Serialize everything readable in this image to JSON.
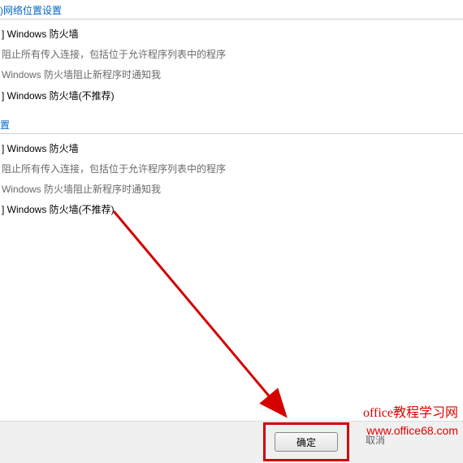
{
  "section1": {
    "header": ")网络位置设置",
    "opt_enable": "] Windows 防火墙",
    "opt_block": "阻止所有传入连接，包括位于允许程序列表中的程序",
    "opt_notify": "Windows 防火墙阻止新程序时通知我",
    "opt_disable": "] Windows 防火墙(不推荐)"
  },
  "section2": {
    "header": "置",
    "opt_enable": "] Windows 防火墙",
    "opt_block": "阻止所有传入连接，包括位于允许程序列表中的程序",
    "opt_notify": "Windows 防火墙阻止新程序时通知我",
    "opt_disable": "] Windows 防火墙(不推荐)"
  },
  "buttons": {
    "ok": "确定",
    "cancel": "取消"
  },
  "watermark": {
    "line1": "office教程学习网",
    "line2": "www.office68.com"
  }
}
